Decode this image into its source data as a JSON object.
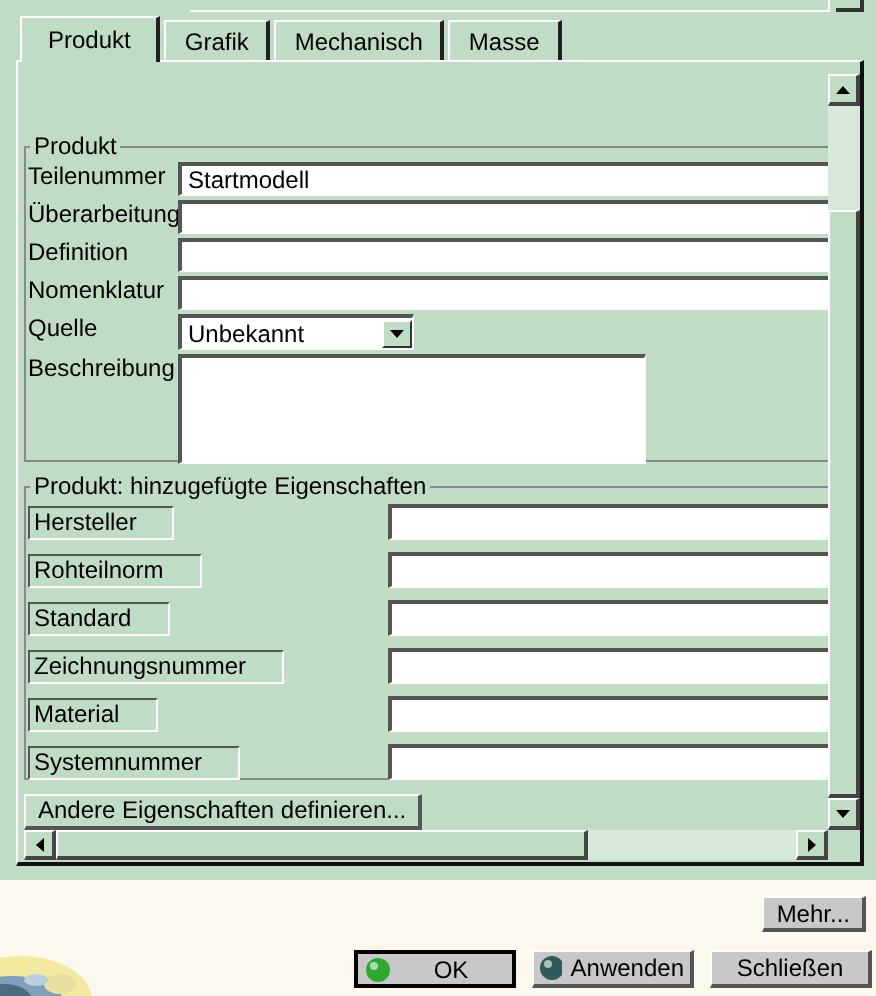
{
  "tabs": [
    {
      "label": "Produkt",
      "selected": true
    },
    {
      "label": "Grafik",
      "selected": false
    },
    {
      "label": "Mechanisch",
      "selected": false
    },
    {
      "label": "Masse",
      "selected": false
    }
  ],
  "product_group": {
    "title": "Produkt",
    "fields": [
      {
        "label": "Teilenummer",
        "kind": "text",
        "value": "Startmodell"
      },
      {
        "label": "Überarbeitung",
        "kind": "text"
      },
      {
        "label": "Definition",
        "kind": "text"
      },
      {
        "label": "Nomenklatur",
        "kind": "text"
      },
      {
        "label": "Quelle",
        "kind": "dropdown",
        "value": "Unbekannt"
      },
      {
        "label": "Beschreibung",
        "kind": "textarea"
      }
    ]
  },
  "added_properties": {
    "title": "Produkt: hinzugefügte Eigenschaften",
    "properties": [
      {
        "label": "Hersteller"
      },
      {
        "label": "Rohteilnorm"
      },
      {
        "label": "Standard"
      },
      {
        "label": "Zeichnungsnummer"
      },
      {
        "label": "Material"
      },
      {
        "label": "Systemnummer"
      }
    ],
    "define_button": "Andere Eigenschaften definieren..."
  },
  "more_button": "Mehr...",
  "buttons": [
    {
      "label": "OK",
      "kind": "default"
    },
    {
      "label": "Anwenden",
      "kind": "apply"
    },
    {
      "label": "Schließen",
      "kind": "plain"
    }
  ]
}
